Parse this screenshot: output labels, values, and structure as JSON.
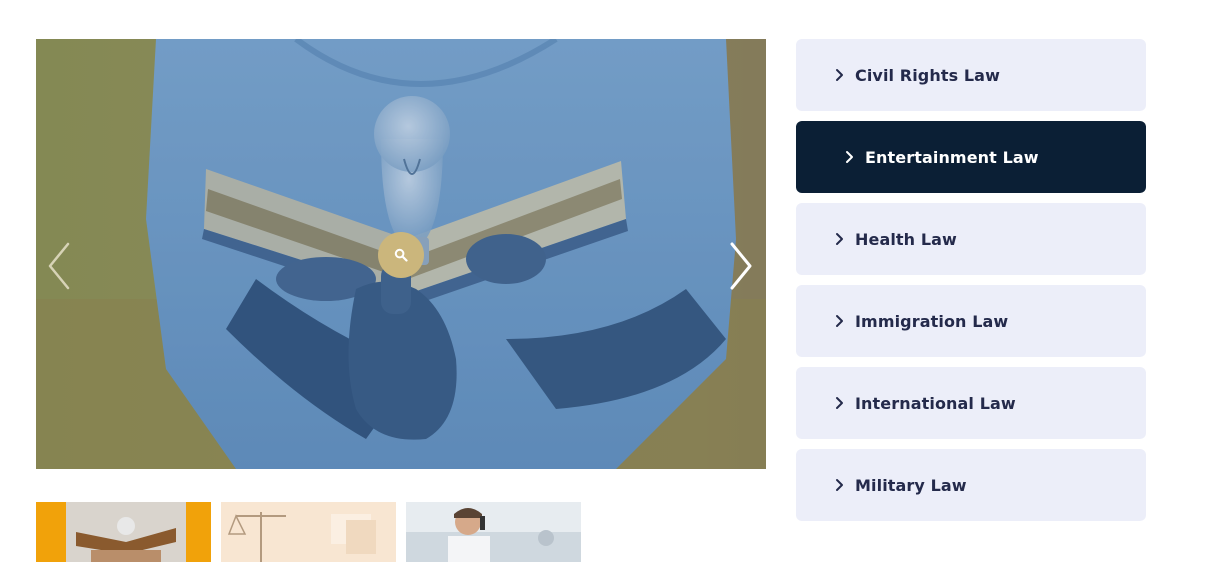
{
  "gallery": {
    "prev_icon": "chevron-left-icon",
    "next_icon": "chevron-right-icon",
    "zoom_icon": "search-icon",
    "zoom_color": "#cbb67c",
    "thumbnail_count": 3
  },
  "menu": {
    "items": [
      {
        "label": "Civil Rights Law",
        "active": false
      },
      {
        "label": "Entertainment Law",
        "active": true
      },
      {
        "label": "Health Law",
        "active": false
      },
      {
        "label": "Immigration Law",
        "active": false
      },
      {
        "label": "International Law",
        "active": false
      },
      {
        "label": "Military Law",
        "active": false
      }
    ],
    "item_bg": "#eceef9",
    "active_bg": "#0b1f35",
    "text_color": "#242a4b",
    "icon": "chevron-right-icon"
  }
}
